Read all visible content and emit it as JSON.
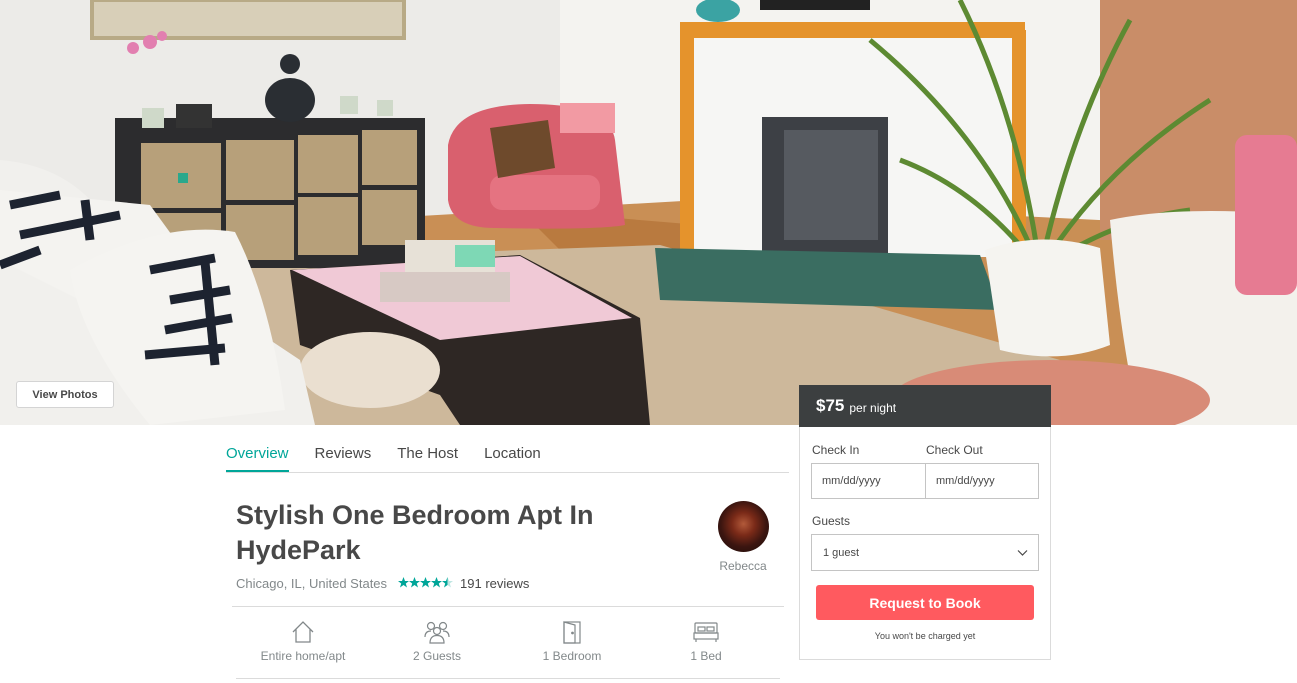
{
  "hero": {
    "view_photos_label": "View Photos"
  },
  "tabs": [
    {
      "label": "Overview",
      "active": true
    },
    {
      "label": "Reviews",
      "active": false
    },
    {
      "label": "The Host",
      "active": false
    },
    {
      "label": "Location",
      "active": false
    }
  ],
  "listing": {
    "title": "Stylish One Bedroom Apt In HydePark",
    "location": "Chicago, IL, United States",
    "rating_stars": 4.5,
    "reviews_label": "191 reviews",
    "host_name": "Rebecca"
  },
  "amenities": [
    {
      "icon": "home-icon",
      "label": "Entire home/apt"
    },
    {
      "icon": "guests-icon",
      "label": "2 Guests"
    },
    {
      "icon": "door-icon",
      "label": "1 Bedroom"
    },
    {
      "icon": "bed-icon",
      "label": "1 Bed"
    }
  ],
  "booking": {
    "price": "$75",
    "price_unit": "per night",
    "check_in_label": "Check In",
    "check_out_label": "Check Out",
    "check_in_placeholder": "mm/dd/yyyy",
    "check_out_placeholder": "mm/dd/yyyy",
    "guests_label": "Guests",
    "guests_value": "1 guest",
    "request_button": "Request to Book",
    "note": "You won't be charged yet"
  },
  "colors": {
    "accent_teal": "#00a699",
    "brand_coral": "#ff5a5f",
    "price_bar": "#3c3f40"
  }
}
